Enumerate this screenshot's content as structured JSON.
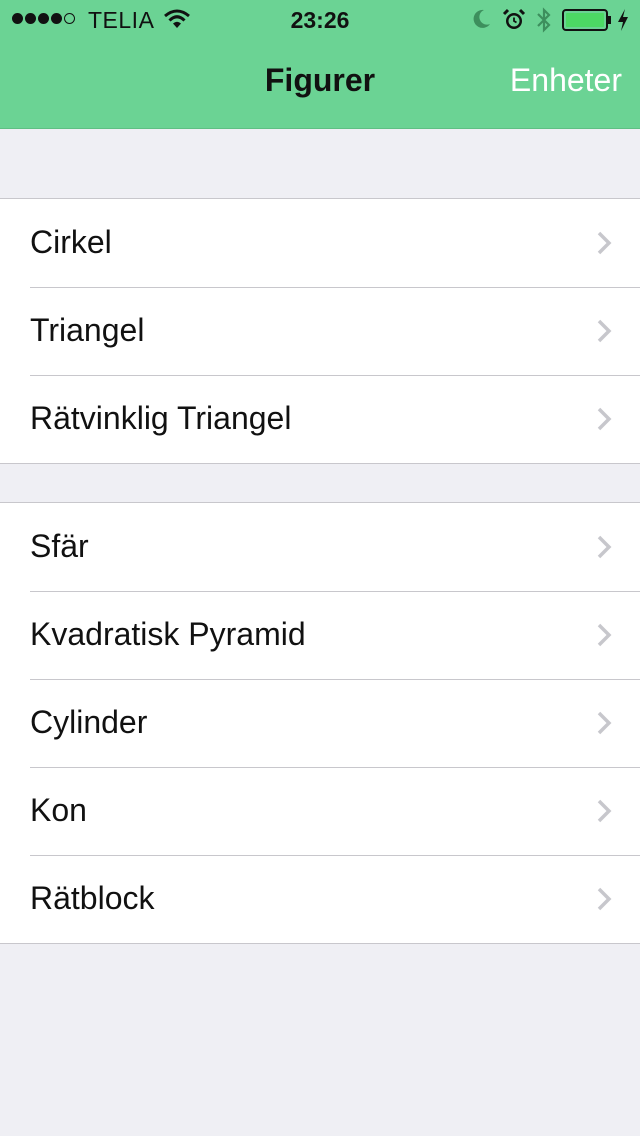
{
  "status_bar": {
    "carrier": "TELIA",
    "time": "23:26",
    "battery_color": "#4cd964",
    "icons": [
      "signal-dots-icon",
      "wifi-icon",
      "moon-icon",
      "alarm-icon",
      "bluetooth-icon",
      "battery-icon",
      "charging-bolt-icon"
    ]
  },
  "nav": {
    "title": "Figurer",
    "right_button": "Enheter",
    "bar_color": "#6bd394"
  },
  "groups": [
    {
      "items": [
        {
          "label": "Cirkel"
        },
        {
          "label": "Triangel"
        },
        {
          "label": "Rätvinklig Triangel"
        }
      ]
    },
    {
      "items": [
        {
          "label": "Sfär"
        },
        {
          "label": "Kvadratisk Pyramid"
        },
        {
          "label": "Cylinder"
        },
        {
          "label": "Kon"
        },
        {
          "label": "Rätblock"
        }
      ]
    }
  ]
}
